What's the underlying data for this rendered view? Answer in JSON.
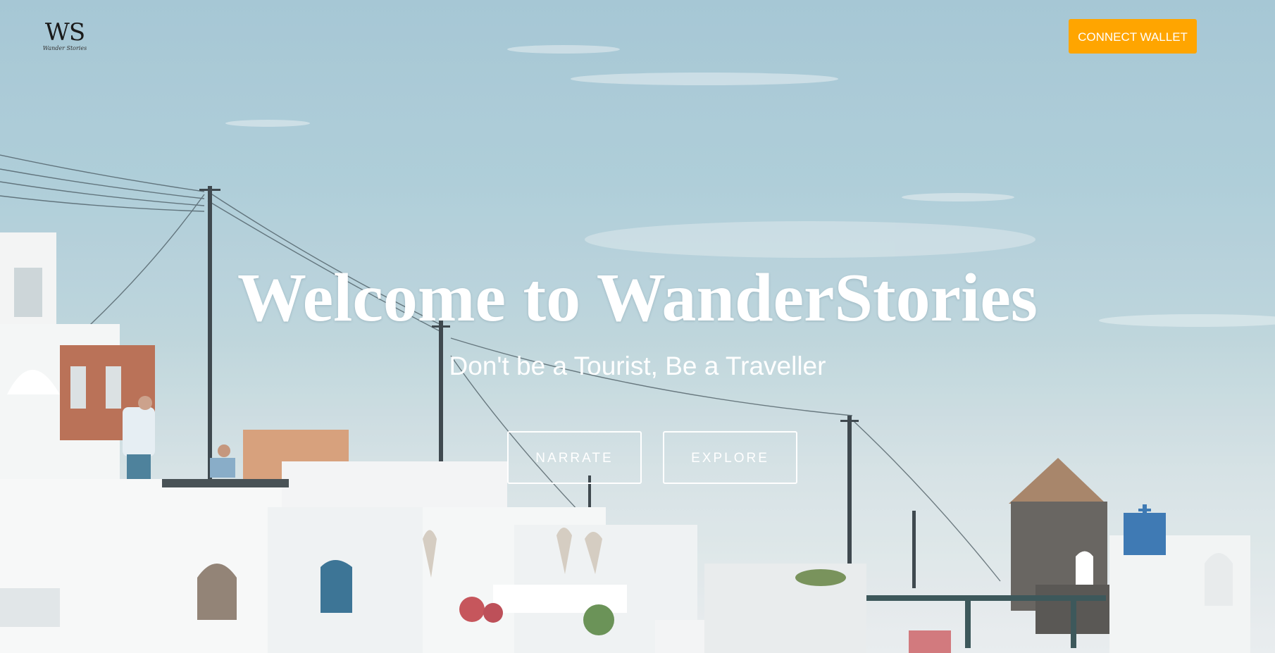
{
  "header": {
    "logo_mark": "WS",
    "logo_sub": "Wander Stories",
    "connect_label": "CONNECT WALLET"
  },
  "hero": {
    "title": "Welcome to WanderStories",
    "subtitle": "Don't be a Tourist, Be a Traveller",
    "narrate_label": "NARRATE",
    "explore_label": "EXPLORE"
  },
  "colors": {
    "accent": "#ffa500",
    "text_light": "#ffffff",
    "sky": "#a9cad6"
  },
  "icons": {
    "logo": "ws-monogram-logo"
  }
}
